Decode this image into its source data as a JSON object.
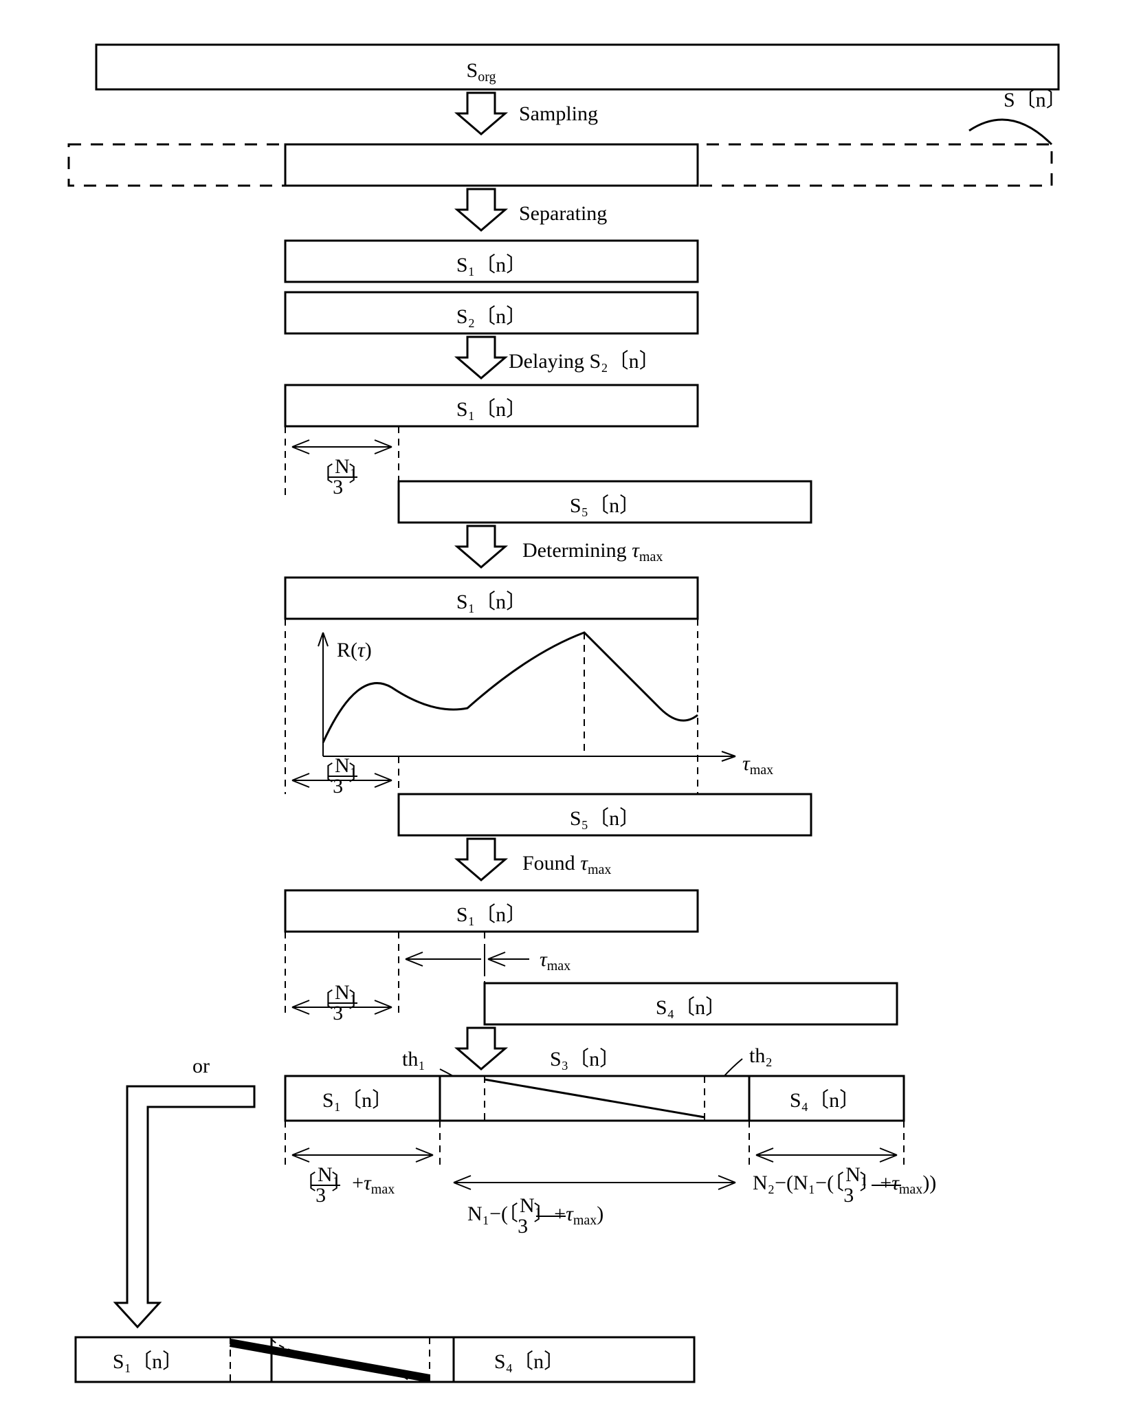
{
  "labels": {
    "sorg": "S",
    "sorg_sub": "org",
    "sampling": "Sampling",
    "sn": "S〔n〕",
    "separating": "Separating",
    "s1n": "S₁〔n〕",
    "s2n": "S₂〔n〕",
    "delaying": "Delaying S₂〔n〕",
    "s5n": "S₅〔n〕",
    "n1_3": "〔",
    "n1_frac_top": "N₁",
    "n1_frac_bot": "3",
    "determining": "Determining",
    "tau_max": "τ",
    "tau_max_sub": "max",
    "rtau": "R(τ)",
    "found": "Found",
    "s4n": "S₄〔n〕",
    "s3n": "S₃〔n〕",
    "th1": "th₁",
    "th2": "th₂",
    "or": "or",
    "dim1": "〔   〕+τ",
    "dim2_a": "N₁−(〔   〕+τ",
    "dim2_b": ")",
    "dim3_a": "N₂−(N₁−(〔   〕+τ",
    "dim3_b": "))"
  }
}
